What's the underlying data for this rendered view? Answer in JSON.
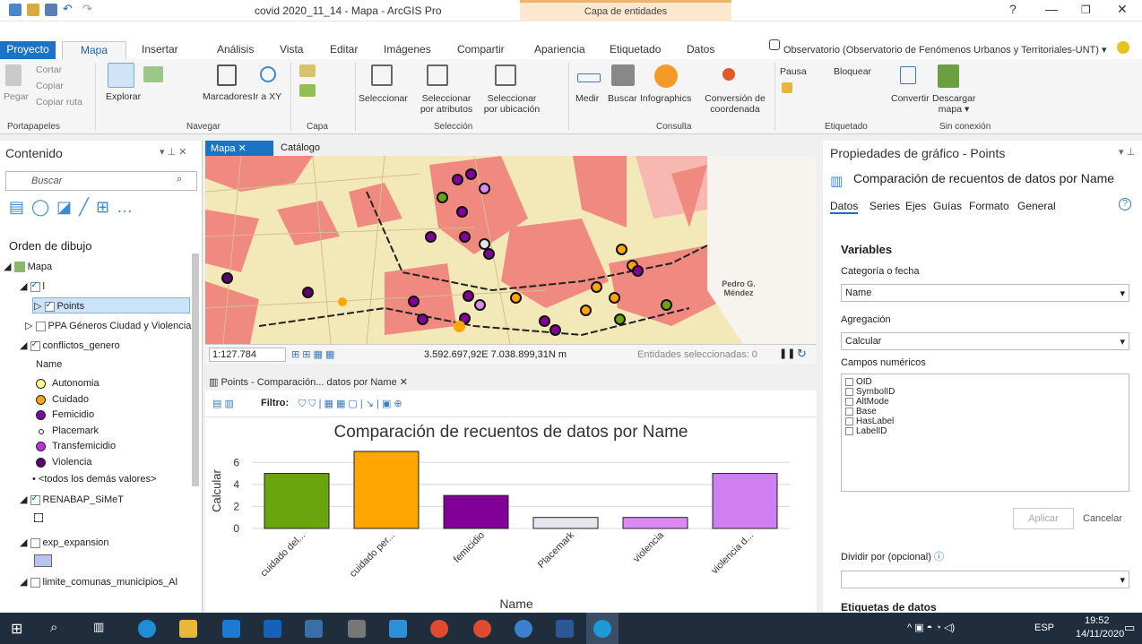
{
  "window": {
    "title": "covid 2020_11_14 - Mapa - ArcGIS Pro",
    "contextual_tab_group": "Capa de entidades",
    "help": "?"
  },
  "tabs": [
    "Proyecto",
    "Mapa",
    "Insertar",
    "Análisis",
    "Vista",
    "Editar",
    "Imágenes",
    "Compartir",
    "Apariencia",
    "Etiquetado",
    "Datos"
  ],
  "portal": "Observatorio (Observatorio de Fenómenos Urbanos y Territoriales-UNT) ▾",
  "ribbon": {
    "clipboard": {
      "paste": "Pegar",
      "cut": "Cortar",
      "copy": "Copiar",
      "copy_path": "Copiar ruta",
      "group": "Portapapeles"
    },
    "navigate": {
      "explore": "Explorar",
      "bookmarks": "Marcadores",
      "goto": "Ir a XY",
      "group": "Navegar"
    },
    "layer": {
      "group": "Capa"
    },
    "selection": {
      "select": "Seleccionar",
      "by_attr": "Seleccionar por atributos",
      "by_loc": "Seleccionar por ubicación",
      "group": "Selección"
    },
    "inquiry": {
      "measure": "Medir",
      "locate": "Buscar",
      "infographics": "Infographics",
      "convert": "Conversión de coordenada",
      "group": "Consulta"
    },
    "labeling": {
      "pause": "Pausa",
      "lock": "Bloquear",
      "group": "Etiquetado"
    },
    "offline": {
      "convert": "Convertir",
      "download": "Descargar mapa ▾",
      "group": "Sin conexión"
    }
  },
  "contents": {
    "title": "Contenido",
    "search_placeholder": "Buscar",
    "draw_order": "Orden de dibujo",
    "layers": {
      "map": "Mapa",
      "group_l": "l",
      "points": "Points",
      "ppa": "PPA Géneros Ciudad y Violencia",
      "conflictos": "conflictos_genero",
      "name_field": "Name",
      "legend": [
        {
          "label": "Autonomia",
          "color": "#ffff99"
        },
        {
          "label": "Cuidado",
          "color": "#ffa500"
        },
        {
          "label": "Femicidio",
          "color": "#7a0aa0"
        },
        {
          "label": "Placemark",
          "color": "#ffffff"
        },
        {
          "label": "Transfemicidio",
          "color": "#c030e0"
        },
        {
          "label": "Violencia",
          "color": "#5a0070"
        }
      ],
      "others": "<todos los demás valores>",
      "renabap": "RENABAP_SiMeT",
      "exp": "exp_expansion",
      "limite": "limite_comunas_municipios_Al"
    }
  },
  "map_view": {
    "tab_map": "Mapa",
    "tab_catalog": "Catálogo",
    "scale": "1:127.784",
    "coords": "3.592.697,92E 7.038.899,31N m",
    "selected": "Entidades seleccionadas: 0",
    "place_label": "Pedro G. Méndez"
  },
  "chart_tab": {
    "title": "Points - Comparación... datos por Name",
    "filter": "Filtro:"
  },
  "chart_data": {
    "type": "bar",
    "title": "Comparación de recuentos de datos por Name",
    "xlabel": "Name",
    "ylabel": "Calcular",
    "categories": [
      "cuidado del...",
      "cuidado per...",
      "femicidio",
      "Placemark",
      "violencia",
      "violencia d..."
    ],
    "values": [
      5,
      7,
      3,
      1,
      1,
      5
    ],
    "colors": [
      "#6aa510",
      "#ffa500",
      "#800098",
      "#e8e4ee",
      "#d98af5",
      "#d07ff2"
    ],
    "ylim": [
      0,
      7
    ],
    "yticks": [
      0,
      2,
      4,
      6
    ],
    "grid": true
  },
  "properties": {
    "title": "Propiedades de gráfico - Points",
    "heading": "Comparación de recuentos de datos por Name",
    "tabs": [
      "Datos",
      "Series",
      "Ejes",
      "Guías",
      "Formato",
      "General"
    ],
    "variables": "Variables",
    "category_label": "Categoría o fecha",
    "category_value": "Name",
    "aggregation_label": "Agregación",
    "aggregation_value": "Calcular",
    "numeric_label": "Campos numéricos",
    "numeric_fields": [
      "OID",
      "SymbolID",
      "AltMode",
      "Base",
      "HasLabel",
      "LabelID"
    ],
    "apply": "Aplicar",
    "cancel": "Cancelar",
    "split_label": "Dividir por (opcional)",
    "labels_heading": "Etiquetas de datos"
  },
  "taskbar": {
    "lang": "ESP",
    "time": "19:52",
    "date": "14/11/2020"
  }
}
